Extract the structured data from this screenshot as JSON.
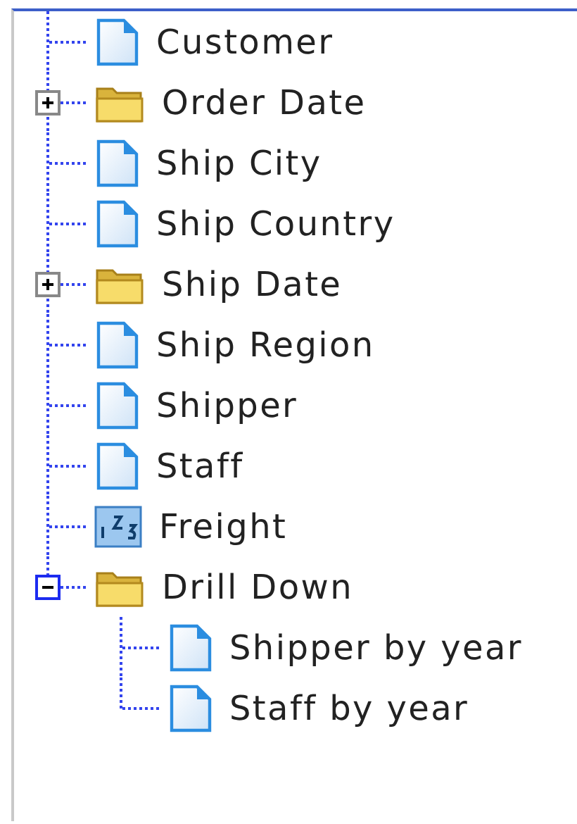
{
  "tree": [
    {
      "kind": "file",
      "label": "Customer"
    },
    {
      "kind": "folder",
      "label": "Order Date",
      "expanded": false
    },
    {
      "kind": "file",
      "label": "Ship City"
    },
    {
      "kind": "file",
      "label": "Ship Country"
    },
    {
      "kind": "folder",
      "label": "Ship Date",
      "expanded": false
    },
    {
      "kind": "file",
      "label": "Ship Region"
    },
    {
      "kind": "file",
      "label": "Shipper"
    },
    {
      "kind": "file",
      "label": "Staff"
    },
    {
      "kind": "number",
      "label": "Freight"
    },
    {
      "kind": "folder",
      "label": "Drill Down",
      "expanded": true,
      "children": [
        {
          "kind": "file",
          "label": "Shipper by year"
        },
        {
          "kind": "file",
          "label": "Staff by year"
        }
      ]
    }
  ]
}
